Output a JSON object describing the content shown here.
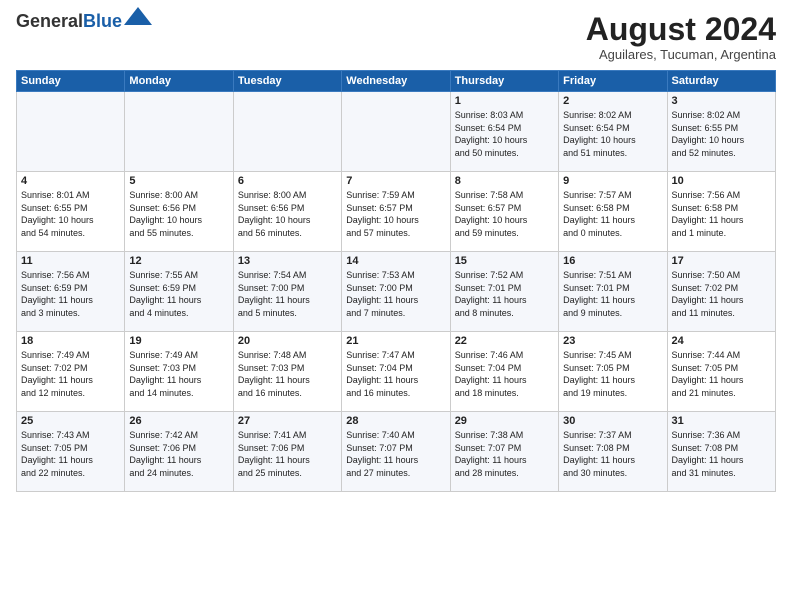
{
  "header": {
    "logo_general": "General",
    "logo_blue": "Blue",
    "month": "August 2024",
    "location": "Aguilares, Tucuman, Argentina"
  },
  "weekdays": [
    "Sunday",
    "Monday",
    "Tuesday",
    "Wednesday",
    "Thursday",
    "Friday",
    "Saturday"
  ],
  "weeks": [
    [
      {
        "day": "",
        "info": ""
      },
      {
        "day": "",
        "info": ""
      },
      {
        "day": "",
        "info": ""
      },
      {
        "day": "",
        "info": ""
      },
      {
        "day": "1",
        "info": "Sunrise: 8:03 AM\nSunset: 6:54 PM\nDaylight: 10 hours\nand 50 minutes."
      },
      {
        "day": "2",
        "info": "Sunrise: 8:02 AM\nSunset: 6:54 PM\nDaylight: 10 hours\nand 51 minutes."
      },
      {
        "day": "3",
        "info": "Sunrise: 8:02 AM\nSunset: 6:55 PM\nDaylight: 10 hours\nand 52 minutes."
      }
    ],
    [
      {
        "day": "4",
        "info": "Sunrise: 8:01 AM\nSunset: 6:55 PM\nDaylight: 10 hours\nand 54 minutes."
      },
      {
        "day": "5",
        "info": "Sunrise: 8:00 AM\nSunset: 6:56 PM\nDaylight: 10 hours\nand 55 minutes."
      },
      {
        "day": "6",
        "info": "Sunrise: 8:00 AM\nSunset: 6:56 PM\nDaylight: 10 hours\nand 56 minutes."
      },
      {
        "day": "7",
        "info": "Sunrise: 7:59 AM\nSunset: 6:57 PM\nDaylight: 10 hours\nand 57 minutes."
      },
      {
        "day": "8",
        "info": "Sunrise: 7:58 AM\nSunset: 6:57 PM\nDaylight: 10 hours\nand 59 minutes."
      },
      {
        "day": "9",
        "info": "Sunrise: 7:57 AM\nSunset: 6:58 PM\nDaylight: 11 hours\nand 0 minutes."
      },
      {
        "day": "10",
        "info": "Sunrise: 7:56 AM\nSunset: 6:58 PM\nDaylight: 11 hours\nand 1 minute."
      }
    ],
    [
      {
        "day": "11",
        "info": "Sunrise: 7:56 AM\nSunset: 6:59 PM\nDaylight: 11 hours\nand 3 minutes."
      },
      {
        "day": "12",
        "info": "Sunrise: 7:55 AM\nSunset: 6:59 PM\nDaylight: 11 hours\nand 4 minutes."
      },
      {
        "day": "13",
        "info": "Sunrise: 7:54 AM\nSunset: 7:00 PM\nDaylight: 11 hours\nand 5 minutes."
      },
      {
        "day": "14",
        "info": "Sunrise: 7:53 AM\nSunset: 7:00 PM\nDaylight: 11 hours\nand 7 minutes."
      },
      {
        "day": "15",
        "info": "Sunrise: 7:52 AM\nSunset: 7:01 PM\nDaylight: 11 hours\nand 8 minutes."
      },
      {
        "day": "16",
        "info": "Sunrise: 7:51 AM\nSunset: 7:01 PM\nDaylight: 11 hours\nand 9 minutes."
      },
      {
        "day": "17",
        "info": "Sunrise: 7:50 AM\nSunset: 7:02 PM\nDaylight: 11 hours\nand 11 minutes."
      }
    ],
    [
      {
        "day": "18",
        "info": "Sunrise: 7:49 AM\nSunset: 7:02 PM\nDaylight: 11 hours\nand 12 minutes."
      },
      {
        "day": "19",
        "info": "Sunrise: 7:49 AM\nSunset: 7:03 PM\nDaylight: 11 hours\nand 14 minutes."
      },
      {
        "day": "20",
        "info": "Sunrise: 7:48 AM\nSunset: 7:03 PM\nDaylight: 11 hours\nand 16 minutes."
      },
      {
        "day": "21",
        "info": "Sunrise: 7:47 AM\nSunset: 7:04 PM\nDaylight: 11 hours\nand 16 minutes."
      },
      {
        "day": "22",
        "info": "Sunrise: 7:46 AM\nSunset: 7:04 PM\nDaylight: 11 hours\nand 18 minutes."
      },
      {
        "day": "23",
        "info": "Sunrise: 7:45 AM\nSunset: 7:05 PM\nDaylight: 11 hours\nand 19 minutes."
      },
      {
        "day": "24",
        "info": "Sunrise: 7:44 AM\nSunset: 7:05 PM\nDaylight: 11 hours\nand 21 minutes."
      }
    ],
    [
      {
        "day": "25",
        "info": "Sunrise: 7:43 AM\nSunset: 7:05 PM\nDaylight: 11 hours\nand 22 minutes."
      },
      {
        "day": "26",
        "info": "Sunrise: 7:42 AM\nSunset: 7:06 PM\nDaylight: 11 hours\nand 24 minutes."
      },
      {
        "day": "27",
        "info": "Sunrise: 7:41 AM\nSunset: 7:06 PM\nDaylight: 11 hours\nand 25 minutes."
      },
      {
        "day": "28",
        "info": "Sunrise: 7:40 AM\nSunset: 7:07 PM\nDaylight: 11 hours\nand 27 minutes."
      },
      {
        "day": "29",
        "info": "Sunrise: 7:38 AM\nSunset: 7:07 PM\nDaylight: 11 hours\nand 28 minutes."
      },
      {
        "day": "30",
        "info": "Sunrise: 7:37 AM\nSunset: 7:08 PM\nDaylight: 11 hours\nand 30 minutes."
      },
      {
        "day": "31",
        "info": "Sunrise: 7:36 AM\nSunset: 7:08 PM\nDaylight: 11 hours\nand 31 minutes."
      }
    ]
  ]
}
